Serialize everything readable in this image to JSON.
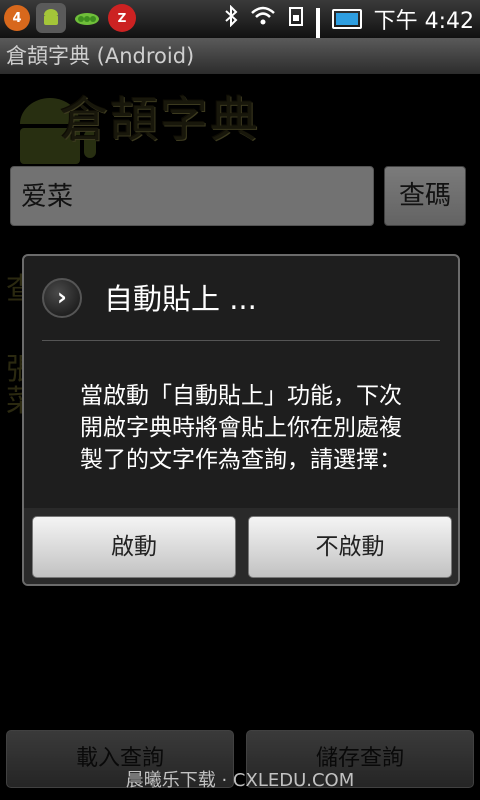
{
  "status_bar": {
    "notification_count": "4",
    "clock_app_glyph": "Z",
    "time": "下午 4:42"
  },
  "app": {
    "window_title": "倉頡字典 (Android)",
    "logo_title": "倉頡字典"
  },
  "search": {
    "input_value": "爱菜",
    "button_label": "查碼"
  },
  "background_chars": [
    "查",
    "張",
    "菜"
  ],
  "dialog": {
    "icon": "chevron-right-icon",
    "title": "自動貼上 ...",
    "message_lines": [
      "當啟動「自動貼上」功能，下次",
      "開啟字典時將會貼上你在別處複",
      "製了的文字作為查詢，請選擇："
    ],
    "enable_label": "啟動",
    "disable_label": "不啟動"
  },
  "bottom_bar": {
    "load_label": "載入查詢",
    "save_label": "儲存查詢"
  },
  "watermark": "晨曦乐下载 · CXLEDU.COM"
}
